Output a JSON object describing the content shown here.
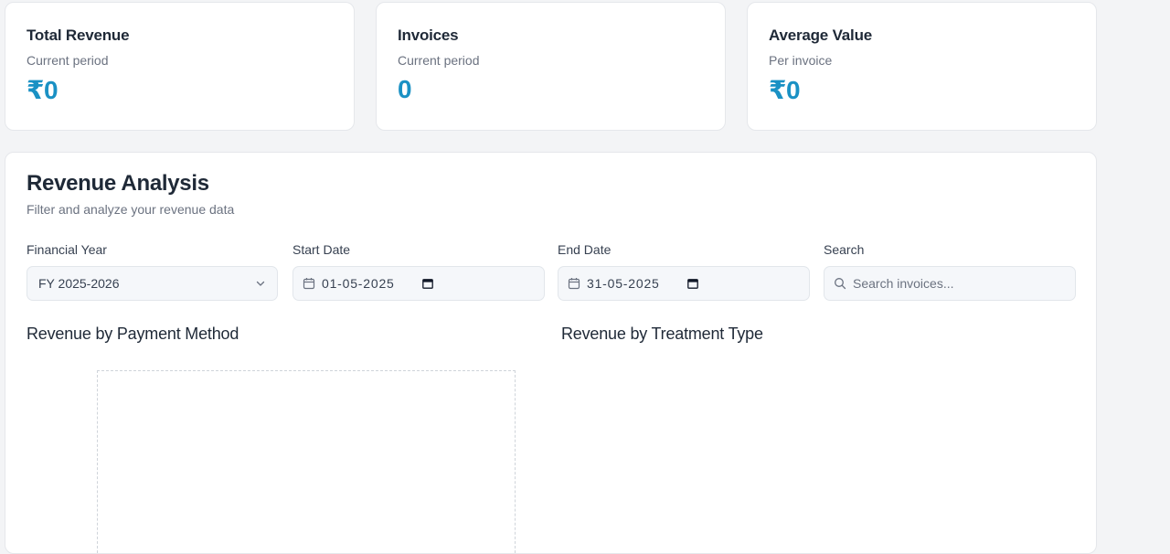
{
  "stats": [
    {
      "title": "Total Revenue",
      "subtitle": "Current period",
      "value": "₹0"
    },
    {
      "title": "Invoices",
      "subtitle": "Current period",
      "value": "0"
    },
    {
      "title": "Average Value",
      "subtitle": "Per invoice",
      "value": "₹0"
    }
  ],
  "analysis": {
    "title": "Revenue Analysis",
    "subtitle": "Filter and analyze your revenue data",
    "filters": {
      "financial_year": {
        "label": "Financial Year",
        "value": "FY 2025-2026",
        "icon": "chevron-down-icon"
      },
      "start_date": {
        "label": "Start Date",
        "value": "01-05-2025",
        "icon": "calendar-icon"
      },
      "end_date": {
        "label": "End Date",
        "value": "31-05-2025",
        "icon": "calendar-icon"
      },
      "search": {
        "label": "Search",
        "placeholder": "Search invoices...",
        "icon": "search-icon"
      }
    },
    "charts": {
      "payment_method": {
        "title": "Revenue by Payment Method"
      },
      "treatment_type": {
        "title": "Revenue by Treatment Type"
      }
    }
  },
  "colors": {
    "accent": "#1a91c4",
    "page_background": "#f3f4f6",
    "card_background": "#ffffff",
    "input_background": "#f5f7fa"
  }
}
